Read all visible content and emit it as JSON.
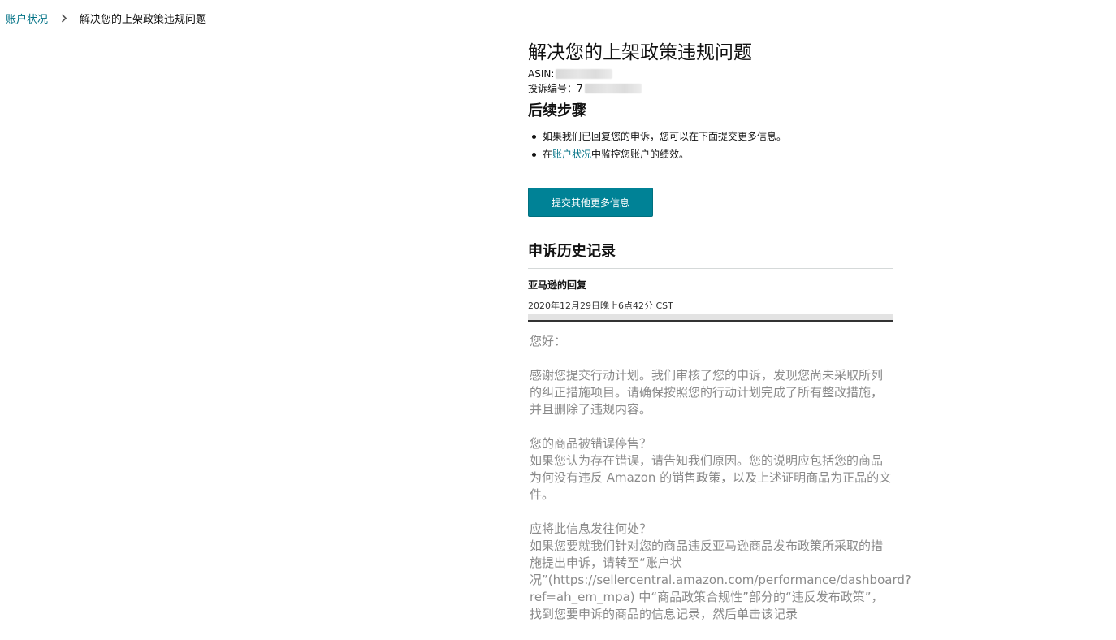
{
  "breadcrumb": {
    "parent": "账户状况",
    "current": "解决您的上架政策违规问题"
  },
  "page": {
    "title": "解决您的上架政策违规问题",
    "asin_label": "ASIN:",
    "complaint_label": "投诉编号：7"
  },
  "next_steps": {
    "heading": "后续步骤",
    "item1": "如果我们已回复您的申诉，您可以在下面提交更多信息。",
    "item2_prefix": "在",
    "item2_link": "账户状况",
    "item2_suffix": "中监控您账户的绩效。"
  },
  "submit_button": "提交其他更多信息",
  "history": {
    "heading": "申诉历史记录",
    "reply_from": "亚马逊的回复",
    "reply_time": "2020年12月29日晚上6点42分 CST"
  },
  "reply_body": {
    "greeting": "您好：",
    "para1": "感谢您提交行动计划。我们审核了您的申诉，发现您尚未采取所列的纠正措施项目。请确保按照您的行动计划完成了所有整改措施，并且删除了违规内容。",
    "q1": "您的商品被错误停售？",
    "a1": "如果您认为存在错误，请告知我们原因。您的说明应包括您的商品为何没有违反 Amazon 的销售政策，以及上述证明商品为正品的文件。",
    "q2": "应将此信息发往何处？",
    "a2": "如果您要就我们针对您的商品违反亚马逊商品发布政策所采取的措施提出申诉，请转至“账户状况”(https://sellercentral.amazon.com/performance/dashboard?ref=ah_em_mpa) 中“商品政策合规性”部分的“违反发布政策”，找到您要申诉的商品的信息记录，然后单击该记录"
  },
  "colors": {
    "link": "#007185",
    "button": "#008296",
    "body_text": "#8a8a8a"
  },
  "icons": {
    "breadcrumb_separator": "chevron-right-icon"
  }
}
